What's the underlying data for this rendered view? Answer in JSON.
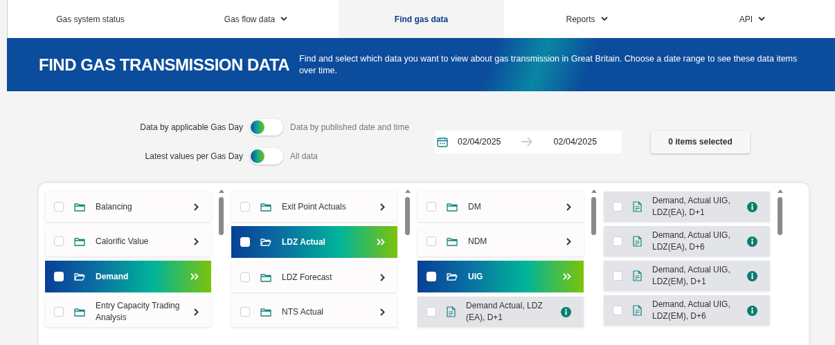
{
  "nav": {
    "tabs": [
      {
        "label": "Gas system status",
        "dropdown": false,
        "selected": false
      },
      {
        "label": "Gas flow data",
        "dropdown": true,
        "selected": false
      },
      {
        "label": "Find gas data",
        "dropdown": false,
        "selected": true
      },
      {
        "label": "Reports",
        "dropdown": true,
        "selected": false
      },
      {
        "label": "API",
        "dropdown": true,
        "selected": false
      }
    ]
  },
  "banner": {
    "title": "FIND GAS TRANSMISSION DATA",
    "description": "Find and select which data you want to view about gas transmission in Great Britain. Choose a date range to see these data items over time."
  },
  "toggles": [
    {
      "left_label": "Data by applicable Gas Day",
      "right_label": "Data by published date and time",
      "on": false
    },
    {
      "left_label": "Latest values per Gas Day",
      "right_label": "All data",
      "on": false
    }
  ],
  "date_range": {
    "start": "02/04/2025",
    "end": "02/04/2025"
  },
  "selection_button": "0 items selected",
  "columns": [
    {
      "items": [
        {
          "kind": "folder",
          "label": "Balancing",
          "checked": false,
          "selected": false
        },
        {
          "kind": "folder",
          "label": "Calorific Value",
          "checked": false,
          "selected": false
        },
        {
          "kind": "folder",
          "label": "Demand",
          "checked": false,
          "selected": true
        },
        {
          "kind": "folder",
          "label": "Entry Capacity Trading Analysis",
          "checked": false,
          "selected": false
        }
      ]
    },
    {
      "items": [
        {
          "kind": "folder",
          "label": "Exit Point Actuals",
          "checked": false,
          "selected": false
        },
        {
          "kind": "folder",
          "label": "LDZ Actual",
          "checked": false,
          "selected": true
        },
        {
          "kind": "folder",
          "label": "LDZ Forecast",
          "checked": false,
          "selected": false
        },
        {
          "kind": "folder",
          "label": "NTS Actual",
          "checked": false,
          "selected": false
        }
      ]
    },
    {
      "items": [
        {
          "kind": "folder",
          "label": "DM",
          "checked": false,
          "selected": false
        },
        {
          "kind": "folder",
          "label": "NDM",
          "checked": false,
          "selected": false
        },
        {
          "kind": "folder",
          "label": "UIG",
          "checked": false,
          "selected": true
        },
        {
          "kind": "file",
          "label": "Demand Actual, LDZ (EA), D+1",
          "checked": false,
          "selected": false
        }
      ]
    },
    {
      "items": [
        {
          "kind": "file",
          "label": "Demand, Actual UIG, LDZ(EA), D+1",
          "checked": false,
          "selected": false
        },
        {
          "kind": "file",
          "label": "Demand, Actual UIG, LDZ(EA), D+6",
          "checked": false,
          "selected": false
        },
        {
          "kind": "file",
          "label": "Demand, Actual UIG, LDZ(EM), D+1",
          "checked": false,
          "selected": false
        },
        {
          "kind": "file",
          "label": "Demand, Actual UIG, LDZ(EM), D+6",
          "checked": false,
          "selected": false
        }
      ]
    }
  ]
}
